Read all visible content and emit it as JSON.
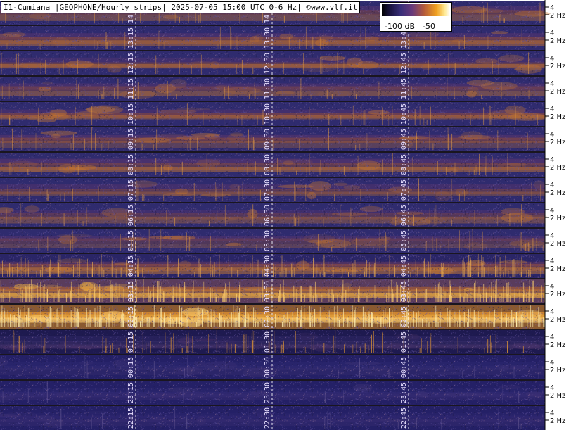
{
  "header": {
    "title": "I1-Cumiana |GEOPHONE/Hourly strips| 2025-07-05 15:00 UTC 0-6 Hz| ©www.vlf.it"
  },
  "colorbar": {
    "low_label": "-100 dB",
    "high_label": "-50"
  },
  "strips": [
    {
      "labels": [
        "14:15",
        "14:30",
        "14:45"
      ],
      "style": "medium"
    },
    {
      "labels": [
        "13:15",
        "13:30",
        "13:45"
      ],
      "style": "medium"
    },
    {
      "labels": [
        "12:15",
        "12:30",
        "12:45"
      ],
      "style": "medium"
    },
    {
      "labels": [
        "11:15",
        "11:30",
        "11:45"
      ],
      "style": "medium"
    },
    {
      "labels": [
        "10:15",
        "10:30",
        "10:45"
      ],
      "style": "medium"
    },
    {
      "labels": [
        "09:15",
        "09:30",
        "09:45"
      ],
      "style": "medium"
    },
    {
      "labels": [
        "08:15",
        "08:30",
        "08:45"
      ],
      "style": "medium"
    },
    {
      "labels": [
        "07:15",
        "07:30",
        "07:45"
      ],
      "style": "medium"
    },
    {
      "labels": [
        "06:15",
        "06:30",
        "06:45"
      ],
      "style": "medium"
    },
    {
      "labels": [
        "05:15",
        "05:30",
        "05:45"
      ],
      "style": "medium"
    },
    {
      "labels": [
        "04:15",
        "04:30",
        "04:45"
      ],
      "style": "streaky"
    },
    {
      "labels": [
        "03:15",
        "03:30",
        "03:45"
      ],
      "style": "bright"
    },
    {
      "labels": [
        "02:15",
        "02:30",
        "02:45"
      ],
      "style": "verybright"
    },
    {
      "labels": [
        "01:15",
        "01:30",
        "01:45"
      ],
      "style": "dark-bursts"
    },
    {
      "labels": [
        "00:15",
        "00:30",
        "00:45"
      ],
      "style": "dark"
    },
    {
      "labels": [
        "23:15",
        "23:30",
        "23:45"
      ],
      "style": "dark"
    },
    {
      "labels": [
        "22:15",
        "22:30",
        "22:45"
      ],
      "style": "dark"
    }
  ],
  "yaxis": {
    "tick4": "4",
    "tick2": "2 Hz"
  },
  "colors": {
    "background": "#2e2a6e",
    "separator": "#1a1620",
    "accent_orange": "#f0a020",
    "gridline": "#ffffff"
  }
}
